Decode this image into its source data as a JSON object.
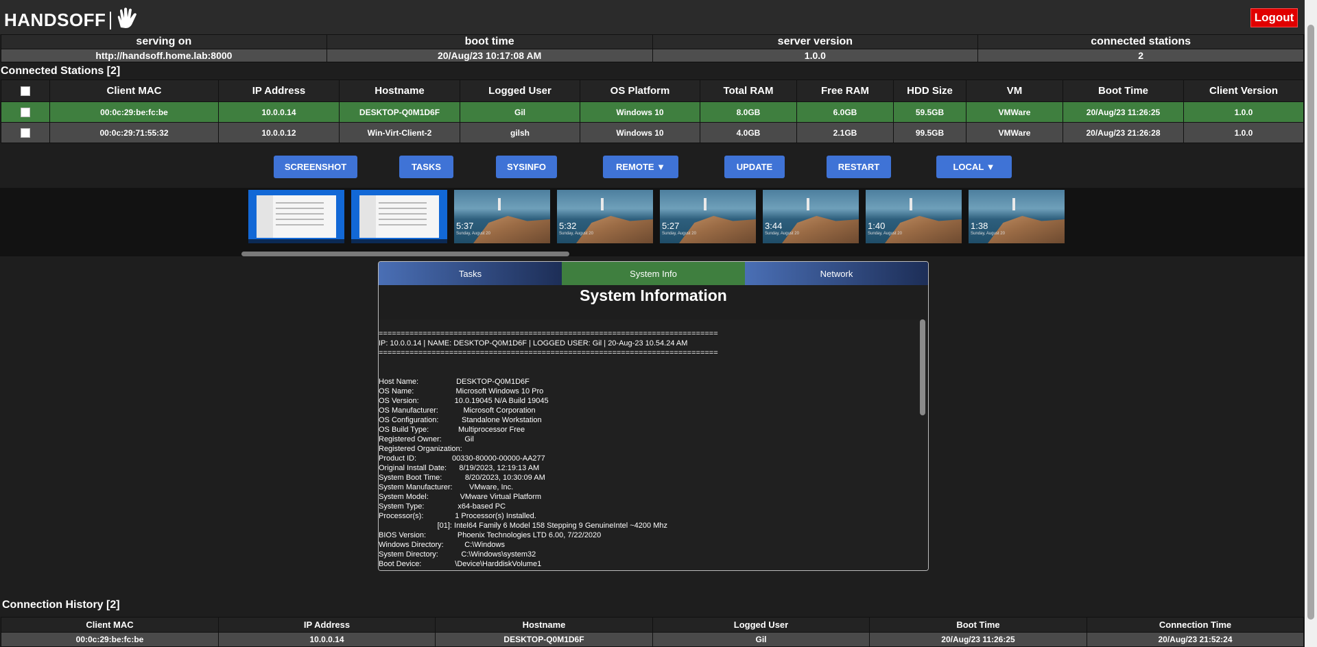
{
  "brand": {
    "name": "HANDSOFF",
    "logo_icon": "hand-icon"
  },
  "logout_label": "Logout",
  "server_info": {
    "headers": [
      "serving on",
      "boot time",
      "server version",
      "connected stations"
    ],
    "values": [
      "http://handsoff.home.lab:8000",
      "20/Aug/23 10:17:08 AM",
      "1.0.0",
      "2"
    ]
  },
  "stations": {
    "title": "Connected Stations [2]",
    "headers": [
      "",
      "Client MAC",
      "IP Address",
      "Hostname",
      "Logged User",
      "OS Platform",
      "Total RAM",
      "Free RAM",
      "HDD Size",
      "VM",
      "Boot Time",
      "Client Version"
    ],
    "rows": [
      {
        "selected": true,
        "cells": [
          "00:0c:29:be:fc:be",
          "10.0.0.14",
          "DESKTOP-Q0M1D6F",
          "Gil",
          "Windows 10",
          "8.0GB",
          "6.0GB",
          "59.5GB",
          "VMWare",
          "20/Aug/23 11:26:25",
          "1.0.0"
        ]
      },
      {
        "selected": false,
        "cells": [
          "00:0c:29:71:55:32",
          "10.0.0.12",
          "Win-Virt-Client-2",
          "gilsh",
          "Windows 10",
          "4.0GB",
          "2.1GB",
          "99.5GB",
          "VMWare",
          "20/Aug/23 21:26:28",
          "1.0.0"
        ]
      }
    ]
  },
  "actions": [
    "SCREENSHOT",
    "TASKS",
    "SYSINFO",
    "REMOTE ▼",
    "UPDATE",
    "RESTART",
    "LOCAL ▼"
  ],
  "screenshots": [
    {
      "kind": "windows-desktop"
    },
    {
      "kind": "windows-desktop"
    },
    {
      "kind": "lockscreen",
      "time": "5:37",
      "date": "Sunday, August 20"
    },
    {
      "kind": "lockscreen",
      "time": "5:32",
      "date": "Sunday, August 20"
    },
    {
      "kind": "lockscreen",
      "time": "5:27",
      "date": "Sunday, August 20"
    },
    {
      "kind": "lockscreen",
      "time": "3:44",
      "date": "Sunday, August 20"
    },
    {
      "kind": "lockscreen",
      "time": "1:40",
      "date": "Sunday, August 20"
    },
    {
      "kind": "lockscreen",
      "time": "1:38",
      "date": "Sunday, August 20"
    }
  ],
  "panel": {
    "tabs": [
      "Tasks",
      "System Info",
      "Network"
    ],
    "active_tab": "System Info",
    "title": "System Information",
    "sysinfo_lines": [
      "",
      "=============================================================================",
      "IP: 10.0.0.14 | NAME: DESKTOP-Q0M1D6F | LOGGED USER: Gil | 20-Aug-23 10.54.24 AM",
      "=============================================================================",
      "",
      "",
      "Host Name:                  DESKTOP-Q0M1D6F",
      "OS Name:                    Microsoft Windows 10 Pro",
      "OS Version:                 10.0.19045 N/A Build 19045",
      "OS Manufacturer:            Microsoft Corporation",
      "OS Configuration:           Standalone Workstation",
      "OS Build Type:              Multiprocessor Free",
      "Registered Owner:           Gil",
      "Registered Organization:",
      "Product ID:                 00330-80000-00000-AA277",
      "Original Install Date:      8/19/2023, 12:19:13 AM",
      "System Boot Time:           8/20/2023, 10:30:09 AM",
      "System Manufacturer:        VMware, Inc.",
      "System Model:               VMware Virtual Platform",
      "System Type:                x64-based PC",
      "Processor(s):               1 Processor(s) Installed.",
      "                            [01]: Intel64 Family 6 Model 158 Stepping 9 GenuineIntel ~4200 Mhz",
      "BIOS Version:               Phoenix Technologies LTD 6.00, 7/22/2020",
      "Windows Directory:          C:\\Windows",
      "System Directory:           C:\\Windows\\system32",
      "Boot Device:                \\Device\\HarddiskVolume1"
    ]
  },
  "history": {
    "title": "Connection History [2]",
    "headers": [
      "Client MAC",
      "IP Address",
      "Hostname",
      "Logged User",
      "Boot Time",
      "Connection Time"
    ],
    "rows": [
      [
        "00:0c:29:be:fc:be",
        "10.0.0.14",
        "DESKTOP-Q0M1D6F",
        "Gil",
        "20/Aug/23 11:26:25",
        "20/Aug/23 21:52:24"
      ]
    ]
  },
  "colors": {
    "selected_row": "#3f7f3f",
    "button": "#3f73d6",
    "logout": "#e00000"
  }
}
